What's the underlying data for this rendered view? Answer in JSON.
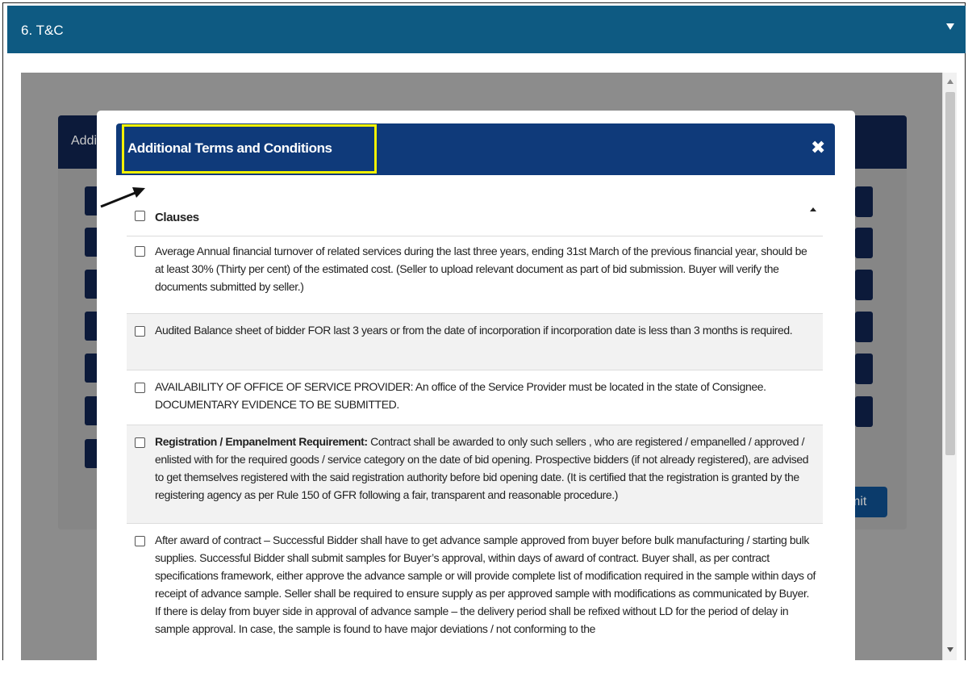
{
  "section": {
    "title": "6. T&C",
    "caret_icon": "caret-down-icon"
  },
  "background_panel": {
    "title_partial": "Addi",
    "submit_partial": "mit"
  },
  "modal": {
    "title": "Additional Terms and Conditions",
    "close_label": "✖",
    "highlight_color": "#f4f100",
    "header_color": "#0f3a7a"
  },
  "table": {
    "header": "Clauses",
    "rows": [
      {
        "text": "Average Annual financial turnover of related services during the last three years, ending 31st March of the previous financial year, should be at least 30% (Thirty per cent) of the estimated cost. (Seller to upload relevant document as part of bid submission. Buyer will verify the documents submitted by seller.)"
      },
      {
        "text": "Audited Balance sheet of bidder FOR last 3 years or from the date of incorporation if incorporation date is less than 3 months is required."
      },
      {
        "text": "AVAILABILITY OF OFFICE OF SERVICE PROVIDER: An office of the Service Provider must be located in the state of Consignee. DOCUMENTARY EVIDENCE TO BE SUBMITTED."
      },
      {
        "bold": "Registration / Empanelment Requirement:",
        "text": "Contract shall be awarded to only such sellers , who are registered / empanelled / approved / enlisted with for the required goods / service category on the date of bid opening. Prospective bidders (if not already registered), are advised to get themselves registered with the said registration authority before bid opening date. (It is certified that the registration is granted by the registering agency as per Rule 150 of GFR following a fair, transparent and reasonable procedure.)"
      },
      {
        "text": "After award of contract – Successful Bidder shall have to get advance sample approved from buyer before bulk manufacturing / starting bulk supplies. Successful Bidder shall submit samples for Buyer’s approval, within days of award of contract. Buyer shall, as per contract specifications framework, either approve the advance sample or will provide complete list of modification required in the sample within days of receipt of advance sample. Seller shall be required to ensure supply as per approved sample with modifications as communicated by Buyer. If there is delay from buyer side in approval of advance sample – the delivery period shall be refixed without LD for the period of delay in sample approval. In case, the sample is found to have major deviations / not conforming to the"
      }
    ]
  }
}
